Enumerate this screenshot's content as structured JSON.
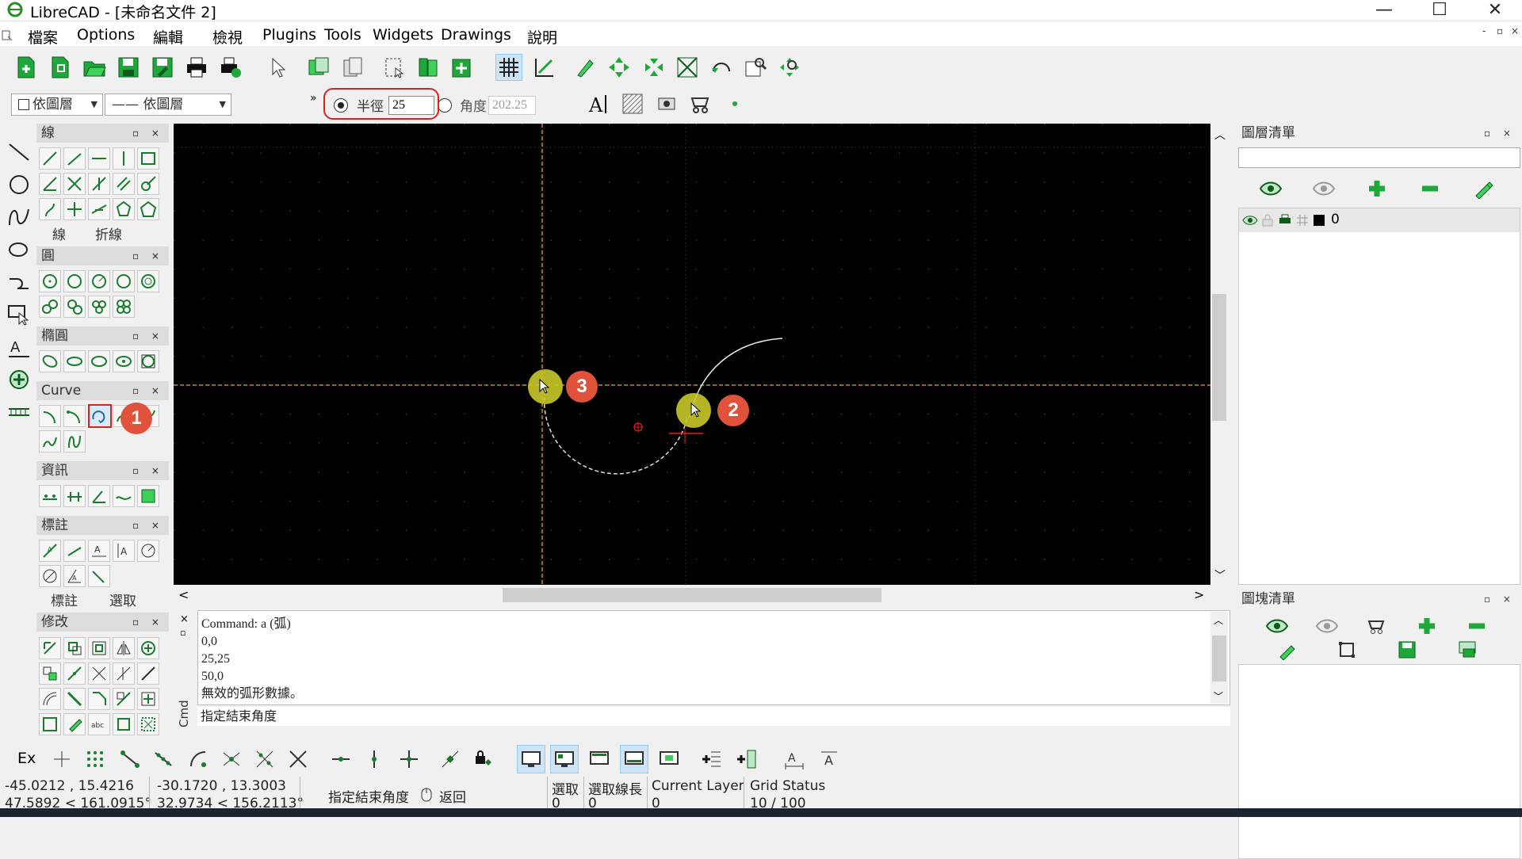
{
  "window": {
    "title": "LibreCAD - [未命名文件 2]",
    "minimize": "—",
    "maximize": "☐",
    "close": "✕"
  },
  "menu": {
    "items": [
      "檔案",
      "Options",
      "編輯",
      "檢視",
      "Plugins",
      "Tools",
      "Widgets",
      "Drawings",
      "說明"
    ],
    "mdi_min": "-",
    "mdi_restore": "▫",
    "mdi_close": "×"
  },
  "pen_toolbar": {
    "color_value": "依圖層",
    "linetype_value": "—— 依圖層",
    "more": "»"
  },
  "arc_options": {
    "radius_label": "半徑",
    "radius_value": "25",
    "angle_label": "角度",
    "angle_value": "202.25",
    "radius_selected": true
  },
  "tool_panels": {
    "line": {
      "title": "線",
      "tabs": [
        "線",
        "折線"
      ]
    },
    "circle": {
      "title": "圓"
    },
    "ellipse": {
      "title": "橢圓"
    },
    "curve": {
      "title": "Curve"
    },
    "info": {
      "title": "資訊"
    },
    "dimension": {
      "title": "標註",
      "tabs": [
        "標註",
        "選取"
      ]
    },
    "modify": {
      "title": "修改"
    },
    "panel_buttons": "▫ ×"
  },
  "command": {
    "lines": [
      "Command: a (弧)",
      "0,0",
      "25,25",
      "50,0",
      "無效的弧形數據。"
    ],
    "prompt": "指定結束角度",
    "side_label": "Cmd"
  },
  "layer_list": {
    "title": "圖層清單",
    "filter_placeholder": "",
    "layers": [
      {
        "name": "0"
      }
    ]
  },
  "block_list": {
    "title": "圖塊清單"
  },
  "annotations": {
    "badges": [
      "1",
      "2",
      "3"
    ],
    "badge_color": "#e0533a",
    "cursor_color": "#c8c828",
    "highlight_color": "#e02020"
  },
  "statusbar": {
    "snap_ex": "Ex",
    "abs_coord": "-45.0212 , 15.4216",
    "abs_polar": "47.5892 < 161.0915°",
    "rel_coord": "-30.1720 , 13.3003",
    "rel_polar": "32.9734 < 156.2113°",
    "prompt": "指定結束角度",
    "back_label": "返回",
    "selected_label": "選取",
    "selected_value": "0",
    "length_label": "選取線長",
    "length_value": "0",
    "layer_label": "Current Layer",
    "layer_value": "0",
    "grid_label": "Grid Status",
    "grid_value": "10 / 100"
  }
}
